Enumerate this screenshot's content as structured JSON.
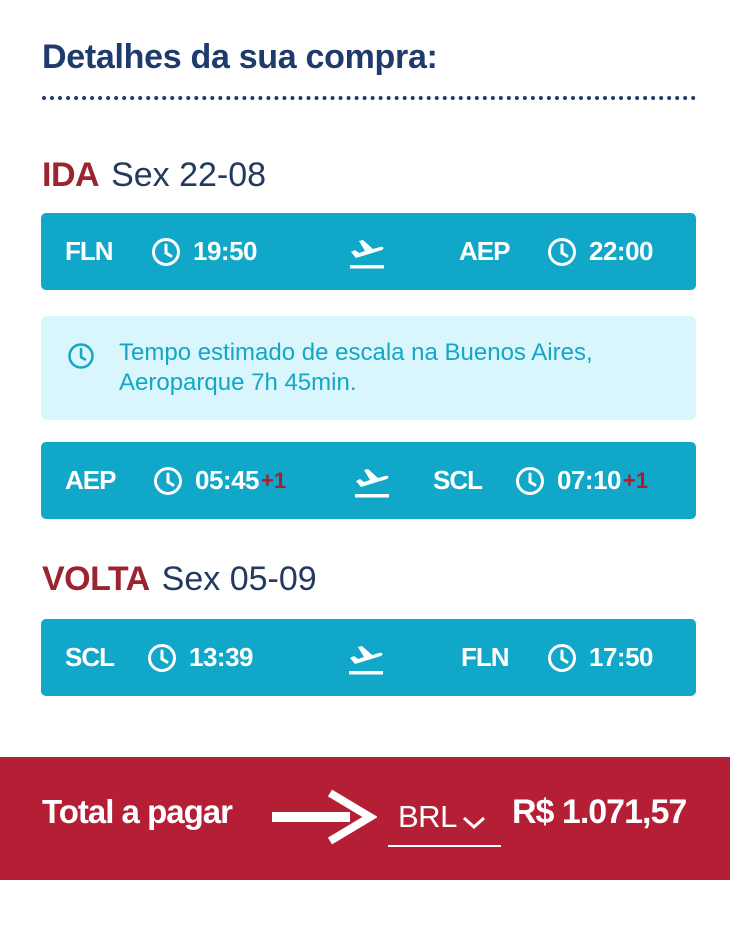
{
  "header": {
    "title": "Detalhes da sua compra:"
  },
  "outbound": {
    "label": "IDA",
    "date": "Sex 22-08",
    "segments": [
      {
        "from": "FLN",
        "dep": "19:50",
        "dep_plus": "",
        "to": "AEP",
        "arr": "22:00",
        "arr_plus": ""
      },
      {
        "from": "AEP",
        "dep": "05:45",
        "dep_plus": "+1",
        "to": "SCL",
        "arr": "07:10",
        "arr_plus": "+1"
      }
    ],
    "layover": {
      "line1": "Tempo estimado de escala na Buenos Aires,",
      "line2": "Aeroparque 7h 45min."
    }
  },
  "return": {
    "label": "VOLTA",
    "date": "Sex 05-09",
    "segments": [
      {
        "from": "SCL",
        "dep": "13:39",
        "dep_plus": "",
        "to": "FLN",
        "arr": "17:50",
        "arr_plus": ""
      }
    ]
  },
  "footer": {
    "total_label": "Total a pagar",
    "currency": "BRL",
    "amount": "R$ 1.071,57"
  },
  "colors": {
    "accent": "#10a7c8",
    "brand_red": "#b51f35",
    "title_blue": "#1f3b6e",
    "info_bg": "#d9f6fd"
  },
  "icons": [
    "clock-icon",
    "airplane-takeoff-icon",
    "arrow-right-icon",
    "chevron-down-icon"
  ]
}
